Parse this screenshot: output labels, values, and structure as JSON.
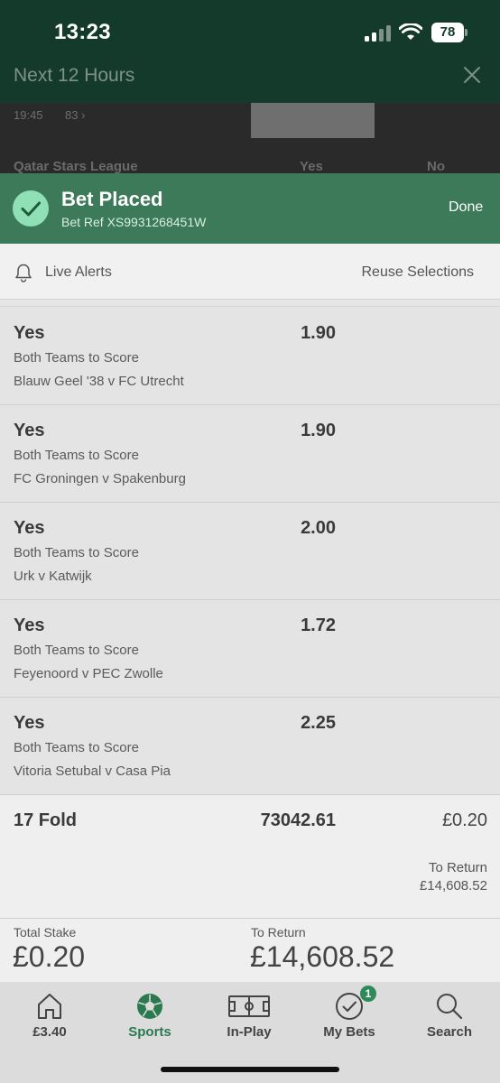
{
  "status_bar": {
    "time": "13:23",
    "battery": "78"
  },
  "background": {
    "title": "Next 12 Hours",
    "row_time": "19:45",
    "row_count": "83",
    "league": "Qatar Stars League",
    "col_yes": "Yes",
    "col_no": "No"
  },
  "banner": {
    "title": "Bet Placed",
    "ref": "Bet Ref XS9931268451W",
    "done": "Done"
  },
  "alerts": {
    "live_alerts": "Live Alerts",
    "reuse": "Reuse Selections"
  },
  "selections": [
    {
      "name": "Yes",
      "odds": "1.90",
      "market": "Both Teams to Score",
      "event": "Blauw Geel '38 v FC Utrecht"
    },
    {
      "name": "Yes",
      "odds": "1.90",
      "market": "Both Teams to Score",
      "event": "FC Groningen v Spakenburg"
    },
    {
      "name": "Yes",
      "odds": "2.00",
      "market": "Both Teams to Score",
      "event": "Urk v Katwijk"
    },
    {
      "name": "Yes",
      "odds": "1.72",
      "market": "Both Teams to Score",
      "event": "Feyenoord v PEC Zwolle"
    },
    {
      "name": "Yes",
      "odds": "2.25",
      "market": "Both Teams to Score",
      "event": "Vitoria Setubal v Casa Pia"
    }
  ],
  "fold": {
    "label": "17 Fold",
    "odds": "73042.61",
    "stake": "£0.20",
    "return_label": "To Return",
    "return_value": "£14,608.52"
  },
  "totals": {
    "stake_label": "Total Stake",
    "stake_value": "£0.20",
    "return_label": "To Return",
    "return_value": "£14,608.52"
  },
  "nav": {
    "items": [
      {
        "label": "£3.40",
        "icon": "home-icon"
      },
      {
        "label": "Sports",
        "icon": "football-icon"
      },
      {
        "label": "In-Play",
        "icon": "pitch-icon"
      },
      {
        "label": "My Bets",
        "icon": "check-circle-icon",
        "badge": "1"
      },
      {
        "label": "Search",
        "icon": "search-icon"
      }
    ],
    "active_color": "#2b7a4f"
  },
  "colors": {
    "header_dark": "#133a2b",
    "banner_green": "#3c7a59",
    "check_mint": "#8fe0b4"
  }
}
